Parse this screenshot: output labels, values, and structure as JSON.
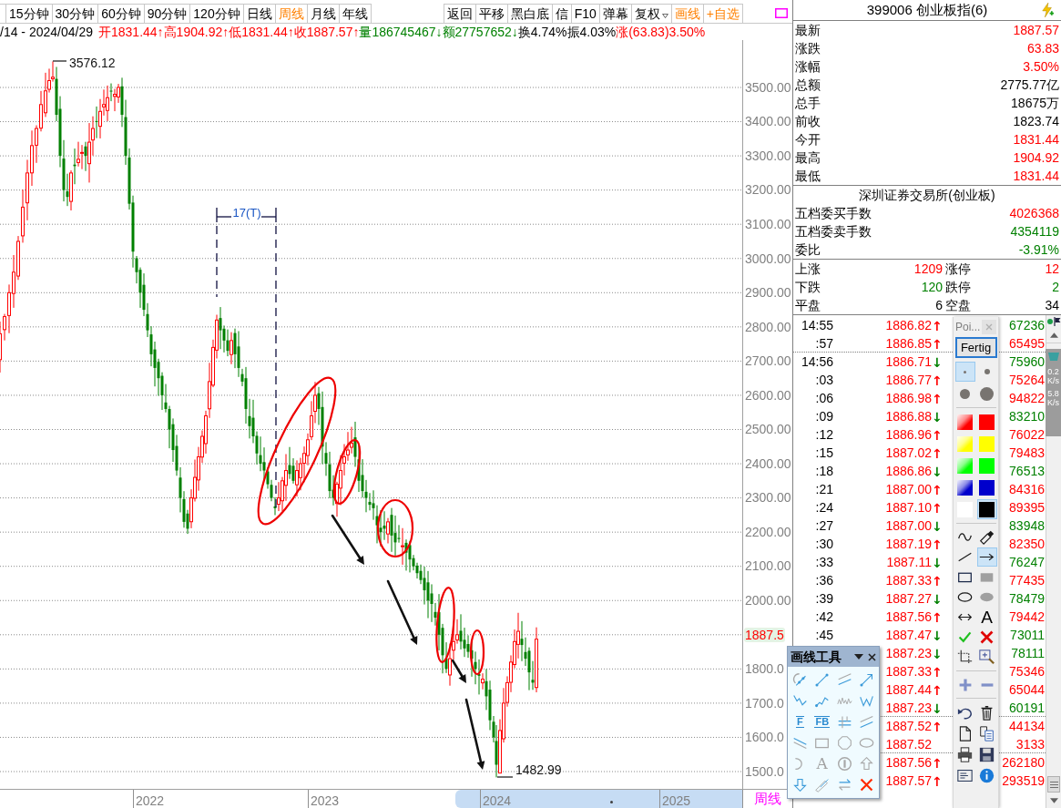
{
  "toolbar": {
    "periods": [
      {
        "label": "15分钟",
        "selected": false
      },
      {
        "label": "30分钟",
        "selected": false
      },
      {
        "label": "60分钟",
        "selected": false
      },
      {
        "label": "90分钟",
        "selected": false
      },
      {
        "label": "120分钟",
        "selected": false
      },
      {
        "label": "日线",
        "selected": false
      },
      {
        "label": "周线",
        "selected": true
      },
      {
        "label": "月线",
        "selected": false
      },
      {
        "label": "年线",
        "selected": false
      }
    ],
    "actions": [
      {
        "label": "返回",
        "kind": "button"
      },
      {
        "label": "平移",
        "kind": "button"
      },
      {
        "label": "黑白底",
        "kind": "button"
      },
      {
        "label": "信",
        "kind": "button"
      },
      {
        "label": "F10",
        "kind": "button"
      },
      {
        "label": "弹幕",
        "kind": "button"
      },
      {
        "label": "复权",
        "kind": "dropdown"
      },
      {
        "label": "画线",
        "kind": "toggle",
        "on": true
      },
      {
        "label": "+自选",
        "kind": "accent"
      }
    ]
  },
  "quote_line": [
    {
      "text": "/14 - 2024/04/29",
      "color": "#000000"
    },
    {
      "text": "开1831.44↑",
      "color": "#ff0000"
    },
    {
      "text": "高1904.92↑",
      "color": "#ff0000"
    },
    {
      "text": "低1831.44↑",
      "color": "#ff0000"
    },
    {
      "text": "收1887.57↑",
      "color": "#ff0000"
    },
    {
      "text": "量186745467↓",
      "color": "#008000"
    },
    {
      "text": "额27757652↓",
      "color": "#008000"
    },
    {
      "text": "换4.74%",
      "color": "#000000"
    },
    {
      "text": "振4.03%",
      "color": "#000000"
    },
    {
      "text": "涨(63.83)3.50%",
      "color": "#ff0000"
    }
  ],
  "chart": {
    "high_label": "3576.12",
    "low_label": "1482.99",
    "measure_label": "17(T)",
    "y_axis": [
      {
        "kind": "level",
        "text": "3500.00"
      },
      {
        "kind": "level",
        "text": "3400.00"
      },
      {
        "kind": "level",
        "text": "3300.00"
      },
      {
        "kind": "level",
        "text": "3200.00"
      },
      {
        "kind": "level",
        "text": "3100.00"
      },
      {
        "kind": "level",
        "text": "3000.00"
      },
      {
        "kind": "level",
        "text": "2900.00"
      },
      {
        "kind": "level",
        "text": "2800.00"
      },
      {
        "kind": "level",
        "text": "2700.00"
      },
      {
        "kind": "level",
        "text": "2600.00"
      },
      {
        "kind": "level",
        "text": "2500.00"
      },
      {
        "kind": "level",
        "text": "2400.00"
      },
      {
        "kind": "level",
        "text": "2300.00"
      },
      {
        "kind": "level",
        "text": "2200.00"
      },
      {
        "kind": "level",
        "text": "2100.00"
      },
      {
        "kind": "level",
        "text": "2000.00"
      },
      {
        "kind": "price_tag",
        "text": "1887.5"
      },
      {
        "kind": "level",
        "text": "1800.0"
      },
      {
        "kind": "level",
        "text": "1700.0"
      },
      {
        "kind": "level",
        "text": "1600.0"
      },
      {
        "kind": "level",
        "text": "1500.0"
      }
    ],
    "x_axis": {
      "labels": [
        "2022",
        "2023",
        "2024",
        "2025"
      ],
      "period": "周线"
    }
  },
  "quote": {
    "title": "399006 创业板指(6)",
    "rows": [
      {
        "label": "最新",
        "value": "1887.57",
        "color": "#ff0000"
      },
      {
        "label": "涨跌",
        "value": "63.83",
        "color": "#ff0000"
      },
      {
        "label": "涨幅",
        "value": "3.50%",
        "color": "#ff0000"
      },
      {
        "label": "总额",
        "value": "2775.77亿",
        "color": "#000000"
      },
      {
        "label": "总手",
        "value": "18675万",
        "color": "#000000"
      },
      {
        "label": "前收",
        "value": "1823.74",
        "color": "#000000"
      },
      {
        "label": "今开",
        "value": "1831.44",
        "color": "#ff0000"
      },
      {
        "label": "最高",
        "value": "1904.92",
        "color": "#ff0000"
      },
      {
        "label": "最低",
        "value": "1831.44",
        "color": "#ff0000"
      }
    ]
  },
  "exchange": {
    "title": "深圳证券交易所(创业板)",
    "rows": [
      {
        "label": "五档委买手数",
        "value": "4026368",
        "color": "#ff0000"
      },
      {
        "label": "五档委卖手数",
        "value": "4354119",
        "color": "#008000"
      },
      {
        "label": "委比",
        "value": "-3.91%",
        "color": "#008000"
      }
    ]
  },
  "breadth": [
    {
      "left_label": "上涨",
      "left_value": "1209",
      "right_label": "涨停",
      "right_value": "12",
      "color": "#ff0000"
    },
    {
      "left_label": "下跌",
      "left_value": "120",
      "right_label": "跌停",
      "right_value": "2",
      "color": "#008000"
    },
    {
      "left_label": "平盘",
      "left_value": "6",
      "right_label": "空盘",
      "right_value": "34",
      "color": "#000000"
    }
  ],
  "ticks": [
    {
      "time": "14:55",
      "price": "1886.82",
      "arrow": {
        "text": "↑",
        "color": "#ff0000"
      },
      "volume": {
        "text": "67236",
        "color": "#008000"
      },
      "divider_above": false
    },
    {
      "time": ":57",
      "price": "1886.85",
      "arrow": {
        "text": "↑",
        "color": "#ff0000"
      },
      "volume": {
        "text": "65495",
        "color": "#ff0000"
      },
      "divider_above": false
    },
    {
      "time": "14:56",
      "price": "1886.71",
      "arrow": {
        "text": "↓",
        "color": "#008000"
      },
      "volume": {
        "text": "75960",
        "color": "#008000"
      },
      "divider_above": true
    },
    {
      "time": ":03",
      "price": "1886.77",
      "arrow": {
        "text": "↑",
        "color": "#ff0000"
      },
      "volume": {
        "text": "75264",
        "color": "#ff0000"
      },
      "divider_above": false
    },
    {
      "time": ":06",
      "price": "1886.98",
      "arrow": {
        "text": "↑",
        "color": "#ff0000"
      },
      "volume": {
        "text": "94822",
        "color": "#ff0000"
      },
      "divider_above": false
    },
    {
      "time": ":09",
      "price": "1886.88",
      "arrow": {
        "text": "↓",
        "color": "#008000"
      },
      "volume": {
        "text": "83210",
        "color": "#008000"
      },
      "divider_above": false
    },
    {
      "time": ":12",
      "price": "1886.96",
      "arrow": {
        "text": "↑",
        "color": "#ff0000"
      },
      "volume": {
        "text": "76022",
        "color": "#ff0000"
      },
      "divider_above": false
    },
    {
      "time": ":15",
      "price": "1887.02",
      "arrow": {
        "text": "↑",
        "color": "#ff0000"
      },
      "volume": {
        "text": "79483",
        "color": "#ff0000"
      },
      "divider_above": false
    },
    {
      "time": ":18",
      "price": "1886.86",
      "arrow": {
        "text": "↓",
        "color": "#008000"
      },
      "volume": {
        "text": "76513",
        "color": "#008000"
      },
      "divider_above": false
    },
    {
      "time": ":21",
      "price": "1887.00",
      "arrow": {
        "text": "↑",
        "color": "#ff0000"
      },
      "volume": {
        "text": "84316",
        "color": "#ff0000"
      },
      "divider_above": false
    },
    {
      "time": ":24",
      "price": "1887.10",
      "arrow": {
        "text": "↑",
        "color": "#ff0000"
      },
      "volume": {
        "text": "89395",
        "color": "#ff0000"
      },
      "divider_above": false
    },
    {
      "time": ":27",
      "price": "1887.00",
      "arrow": {
        "text": "↓",
        "color": "#008000"
      },
      "volume": {
        "text": "83948",
        "color": "#008000"
      },
      "divider_above": false
    },
    {
      "time": ":30",
      "price": "1887.19",
      "arrow": {
        "text": "↑",
        "color": "#ff0000"
      },
      "volume": {
        "text": "82350",
        "color": "#ff0000"
      },
      "divider_above": false
    },
    {
      "time": ":33",
      "price": "1887.11",
      "arrow": {
        "text": "↓",
        "color": "#008000"
      },
      "volume": {
        "text": "76247",
        "color": "#008000"
      },
      "divider_above": false
    },
    {
      "time": ":36",
      "price": "1887.33",
      "arrow": {
        "text": "↑",
        "color": "#ff0000"
      },
      "volume": {
        "text": "77435",
        "color": "#ff0000"
      },
      "divider_above": false
    },
    {
      "time": ":39",
      "price": "1887.27",
      "arrow": {
        "text": "↓",
        "color": "#008000"
      },
      "volume": {
        "text": "78479",
        "color": "#008000"
      },
      "divider_above": false
    },
    {
      "time": ":42",
      "price": "1887.56",
      "arrow": {
        "text": "↑",
        "color": "#ff0000"
      },
      "volume": {
        "text": "79442",
        "color": "#ff0000"
      },
      "divider_above": false
    },
    {
      "time": ":45",
      "price": "1887.47",
      "arrow": {
        "text": "↓",
        "color": "#008000"
      },
      "volume": {
        "text": "73011",
        "color": "#008000"
      },
      "divider_above": false
    },
    {
      "price": "1887.23",
      "arrow": {
        "text": "↓",
        "color": "#008000"
      },
      "volume": {
        "text": "78111",
        "color": "#008000"
      },
      "divider_above": false
    },
    {
      "price": "1887.33",
      "arrow": {
        "text": "↑",
        "color": "#ff0000"
      },
      "volume": {
        "text": "75346",
        "color": "#ff0000"
      },
      "divider_above": false
    },
    {
      "price": "1887.44",
      "arrow": {
        "text": "↑",
        "color": "#ff0000"
      },
      "volume": {
        "text": "65044",
        "color": "#ff0000"
      },
      "divider_above": false
    },
    {
      "price": "1887.23",
      "arrow": {
        "text": "↓",
        "color": "#008000"
      },
      "volume": {
        "text": "60191",
        "color": "#008000"
      },
      "divider_above": false
    },
    {
      "price": "1887.52",
      "arrow": {
        "text": "↑",
        "color": "#ff0000"
      },
      "volume": {
        "text": "44134",
        "color": "#ff0000"
      },
      "divider_above": true
    },
    {
      "price": "1887.52",
      "volume": {
        "text": "3133",
        "color": "#ff0000"
      },
      "divider_above": false
    },
    {
      "price": "1887.56",
      "arrow": {
        "text": "↑",
        "color": "#ff0000"
      },
      "volume": {
        "text": "262180",
        "color": "#ff0000"
      },
      "divider_above": true
    },
    {
      "price": "1887.57",
      "arrow": {
        "text": "↑",
        "color": "#ff0000"
      },
      "volume": {
        "text": "293519",
        "color": "#ff0000"
      },
      "divider_above": false
    }
  ],
  "speed_widget": {
    "rates": [
      {
        "value": "0.2",
        "unit": "K/s"
      },
      {
        "value": "5.8",
        "unit": "K/s"
      }
    ]
  },
  "annotation_palette": {
    "title": "Poi...",
    "done_button": "Fertig",
    "dot_sizes": [
      {
        "selected": true
      },
      {
        "selected": false
      },
      {
        "selected": false
      },
      {
        "selected": false
      }
    ],
    "colors": [
      {
        "kind": "gradient",
        "color": "#ff0000",
        "selected": false
      },
      {
        "kind": "solid",
        "color": "#ff0000",
        "selected": false
      },
      {
        "kind": "gradient",
        "color": "#ffff00",
        "selected": false
      },
      {
        "kind": "solid",
        "color": "#ffff00",
        "selected": false
      },
      {
        "kind": "gradient",
        "color": "#00ff00",
        "selected": false
      },
      {
        "kind": "solid",
        "color": "#00ff00",
        "selected": false
      },
      {
        "kind": "gradient",
        "color": "#0000cc",
        "selected": false
      },
      {
        "kind": "solid",
        "color": "#0000cc",
        "selected": false
      },
      {
        "kind": "solid",
        "color": "#ffffff",
        "selected": false
      },
      {
        "kind": "solid",
        "color": "#000000",
        "selected": true
      }
    ],
    "tools": [
      {
        "kind": "curve",
        "selected": false
      },
      {
        "kind": "eraser",
        "selected": false
      },
      {
        "kind": "line",
        "selected": false
      },
      {
        "kind": "arrow",
        "selected": true
      },
      {
        "kind": "rectangle",
        "selected": false
      },
      {
        "kind": "filled-rectangle",
        "selected": false
      },
      {
        "kind": "ellipse",
        "selected": false
      },
      {
        "kind": "filled-ellipse",
        "selected": false
      },
      {
        "kind": "double-arrow",
        "selected": false
      },
      {
        "kind": "text-tool",
        "label": "A",
        "selected": false
      },
      {
        "kind": "checkmark",
        "selected": false
      },
      {
        "kind": "cross",
        "selected": false
      },
      {
        "kind": "crop",
        "selected": false
      },
      {
        "kind": "zoom-in",
        "selected": false
      }
    ],
    "zoom_buttons": [
      {
        "kind": "plus"
      },
      {
        "kind": "minus"
      }
    ],
    "file_actions": [
      {
        "kind": "undo"
      },
      {
        "kind": "trash"
      },
      {
        "kind": "document"
      },
      {
        "kind": "copy"
      },
      {
        "kind": "printer"
      },
      {
        "kind": "save"
      },
      {
        "kind": "window"
      },
      {
        "kind": "info"
      }
    ]
  },
  "drawing_tools": {
    "title": "画线工具",
    "tools": [
      {
        "kind": "arc-dots"
      },
      {
        "kind": "segment"
      },
      {
        "kind": "parallel-lines"
      },
      {
        "kind": "arrow-line"
      },
      {
        "kind": "zigzag"
      },
      {
        "kind": "dotted-zigzag"
      },
      {
        "kind": "wave"
      },
      {
        "kind": "w-zigzag"
      },
      {
        "kind": "fib-lines",
        "label": "F"
      },
      {
        "kind": "fib-lines",
        "label": "FB"
      },
      {
        "kind": "grid-lines"
      },
      {
        "kind": "slant-lines"
      },
      {
        "kind": "falling-line"
      },
      {
        "kind": "rectangle"
      },
      {
        "kind": "octagon"
      },
      {
        "kind": "ellipse"
      },
      {
        "kind": "arc"
      },
      {
        "kind": "text-tool",
        "label": "A"
      },
      {
        "kind": "circle-bar"
      },
      {
        "kind": "up-arrow"
      },
      {
        "kind": "down-arrow"
      },
      {
        "kind": "pencil"
      },
      {
        "kind": "swap-arrows"
      },
      {
        "kind": "cross"
      }
    ]
  }
}
